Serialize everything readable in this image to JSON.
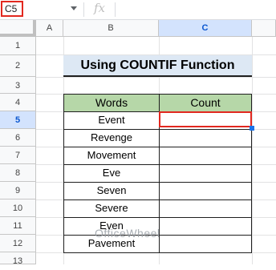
{
  "formula_bar": {
    "name_box": "C5",
    "fx_label": "fx",
    "formula": ""
  },
  "columns": [
    "A",
    "B",
    "C"
  ],
  "rows": [
    "1",
    "2",
    "3",
    "4",
    "5",
    "6",
    "7",
    "8",
    "9",
    "10",
    "11",
    "12",
    "13"
  ],
  "selected_cell": "C5",
  "sheet": {
    "title": "Using COUNTIF Function",
    "table_headers": [
      "Words",
      "Count"
    ],
    "words": [
      "Event",
      "Revenge",
      "Movement",
      "Eve",
      "Seven",
      "Severe",
      "Even",
      "Pavement"
    ],
    "counts": [
      "",
      "",
      "",
      "",
      "",
      "",
      "",
      ""
    ]
  },
  "watermark": "OfficeWheel",
  "colors": {
    "title_bg": "#dde8f4",
    "header_bg": "#b6d7a8",
    "selection": "#e2281f",
    "fill_handle": "#1a73e8"
  }
}
